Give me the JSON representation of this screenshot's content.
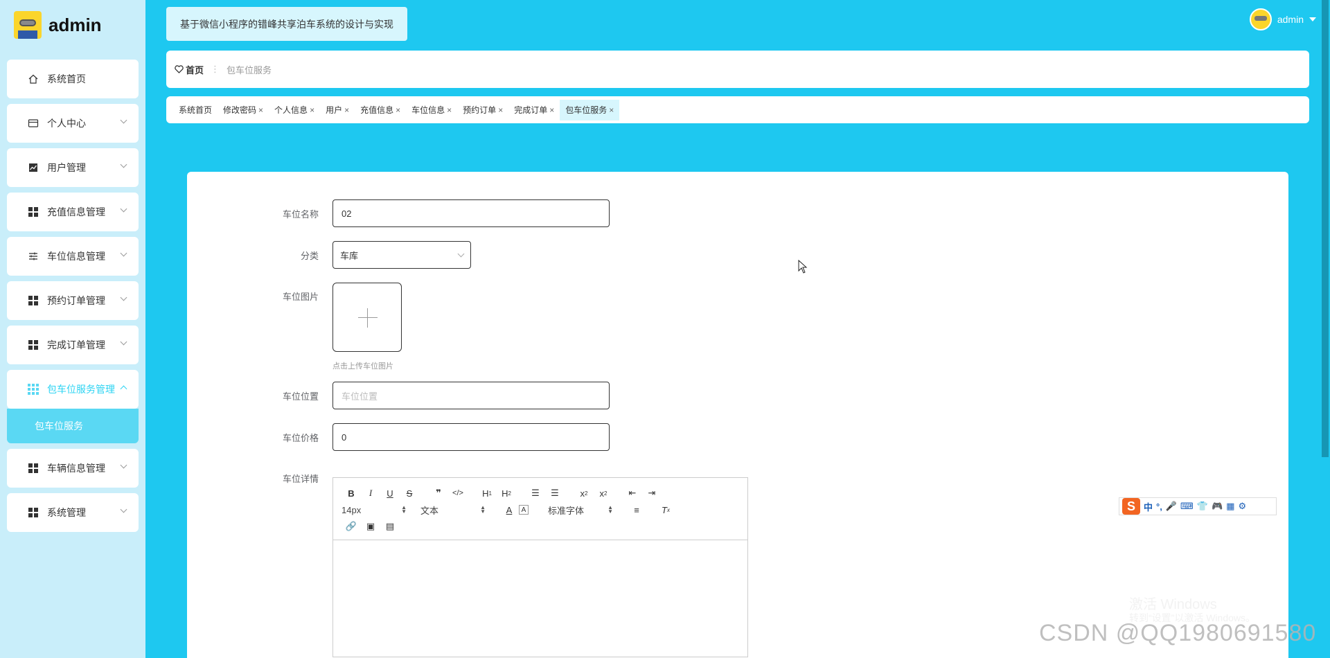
{
  "app": {
    "logo_text": "admin",
    "system_title": "基于微信小程序的错峰共享泊车系统的设计与实现"
  },
  "user": {
    "name": "admin"
  },
  "sidebar": {
    "items": [
      {
        "label": "系统首页",
        "icon": "home-icon"
      },
      {
        "label": "个人中心",
        "icon": "card-icon"
      },
      {
        "label": "用户管理",
        "icon": "chart-icon"
      },
      {
        "label": "充值信息管理",
        "icon": "grid-icon"
      },
      {
        "label": "车位信息管理",
        "icon": "sliders-icon"
      },
      {
        "label": "预约订单管理",
        "icon": "grid-icon"
      },
      {
        "label": "完成订单管理",
        "icon": "grid-icon"
      },
      {
        "label": "包车位服务管理",
        "icon": "grid9-icon"
      },
      {
        "label": "车辆信息管理",
        "icon": "grid-icon"
      },
      {
        "label": "系统管理",
        "icon": "grid-icon"
      }
    ],
    "sub_item": "包车位服务"
  },
  "breadcrumb": {
    "home": "首页",
    "current": "包车位服务"
  },
  "tabs": [
    "系统首页",
    "修改密码",
    "个人信息",
    "用户",
    "充值信息",
    "车位信息",
    "预约订单",
    "完成订单",
    "包车位服务"
  ],
  "form": {
    "name": {
      "label": "车位名称",
      "value": "02"
    },
    "category": {
      "label": "分类",
      "value": "车库"
    },
    "image": {
      "label": "车位图片",
      "hint": "点击上传车位图片"
    },
    "location": {
      "label": "车位位置",
      "placeholder": "车位位置"
    },
    "price": {
      "label": "车位价格",
      "value": "0"
    },
    "detail": {
      "label": "车位详情"
    }
  },
  "editor": {
    "font_size": "14px",
    "text_style": "文本",
    "font_family": "标准字体"
  },
  "ime": {
    "chars": [
      "中",
      "°,"
    ]
  },
  "watermark": {
    "windows_title": "激活 Windows",
    "windows_sub": "转到“设置”以激活 Windows。",
    "csdn": "CSDN @QQ1980691580"
  }
}
